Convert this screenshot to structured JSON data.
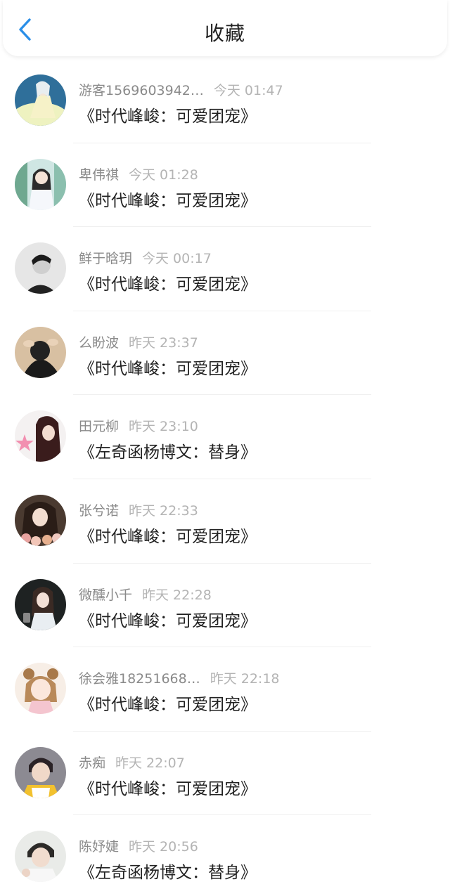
{
  "header": {
    "title": "收藏",
    "back_icon": "chevron-left-icon",
    "accent_color": "#2b8fe8"
  },
  "items": [
    {
      "name": "游客1569603942…",
      "time": "今天 01:47",
      "title": "《时代峰峻：可爱团宠》"
    },
    {
      "name": "卑伟祺",
      "time": "今天 01:28",
      "title": "《时代峰峻：可爱团宠》"
    },
    {
      "name": "鲜于晗玥",
      "time": "今天 00:17",
      "title": "《时代峰峻：可爱团宠》"
    },
    {
      "name": "么盼波",
      "time": "昨天 23:37",
      "title": "《时代峰峻：可爱团宠》"
    },
    {
      "name": "田元柳",
      "time": "昨天 23:10",
      "title": "《左奇函杨博文：替身》"
    },
    {
      "name": "张兮诺",
      "time": "昨天 22:33",
      "title": "《时代峰峻：可爱团宠》"
    },
    {
      "name": "微醺小千",
      "time": "昨天 22:28",
      "title": "《时代峰峻：可爱团宠》"
    },
    {
      "name": "徐会雅18251668…",
      "time": "昨天 22:18",
      "title": "《时代峰峻：可爱团宠》"
    },
    {
      "name": "赤痴",
      "time": "昨天 22:07",
      "title": "《时代峰峻：可爱团宠》"
    },
    {
      "name": "陈妤婕",
      "time": "昨天 20:56",
      "title": "《左奇函杨博文：替身》"
    }
  ]
}
